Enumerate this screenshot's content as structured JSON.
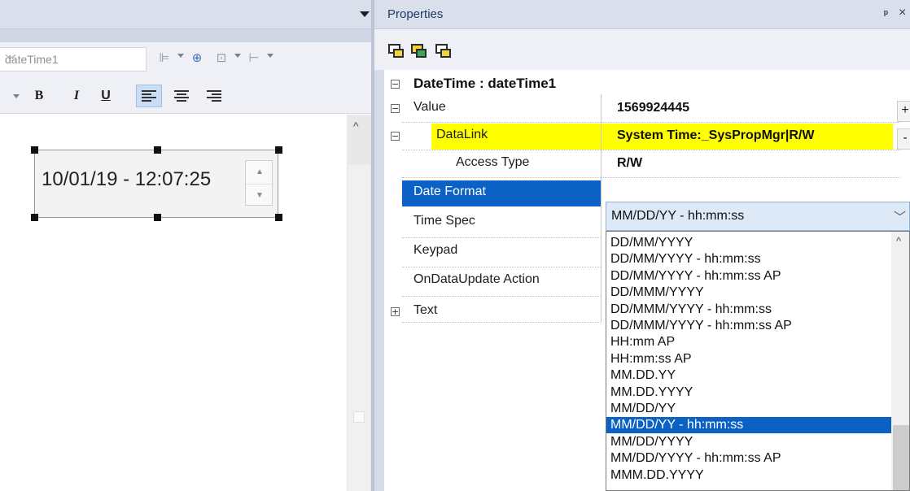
{
  "editor": {
    "object_selector": "dateTime1",
    "format_buttons": {
      "bold": "B",
      "italic": "I",
      "underline": "U"
    },
    "widget_text": "10/01/19 - 12:07:25"
  },
  "properties": {
    "title": "Properties",
    "category": "DateTime : dateTime1",
    "rows": {
      "value_name": "Value",
      "value_val": "1569924445",
      "datalink_name": "DataLink",
      "datalink_val": "System Time:_SysPropMgr|R/W",
      "access_name": "Access Type",
      "access_val": "R/W",
      "dateformat_name": "Date Format",
      "timespec_name": "Time Spec",
      "keypad_name": "Keypad",
      "ondata_name": "OnDataUpdate Action",
      "text_name": "Text"
    },
    "side_buttons": {
      "plus": "+",
      "minus": "-"
    },
    "combo_value": "MM/DD/YY - hh:mm:ss",
    "options": [
      "DD/MM/YYYY",
      "DD/MM/YYYY - hh:mm:ss",
      "DD/MM/YYYY - hh:mm:ss AP",
      "DD/MMM/YYYY",
      "DD/MMM/YYYY - hh:mm:ss",
      "DD/MMM/YYYY - hh:mm:ss AP",
      "HH:mm AP",
      "HH:mm:ss AP",
      "MM.DD.YY",
      "MM.DD.YYYY",
      "MM/DD/YY",
      "MM/DD/YY - hh:mm:ss",
      "MM/DD/YYYY",
      "MM/DD/YYYY - hh:mm:ss AP",
      "MMM.DD.YYYY"
    ],
    "selected_option_index": 11
  },
  "colors": {
    "selection_blue": "#0b62c4",
    "highlight_yellow": "#ffff00",
    "header_bg": "#d9dfeb"
  }
}
